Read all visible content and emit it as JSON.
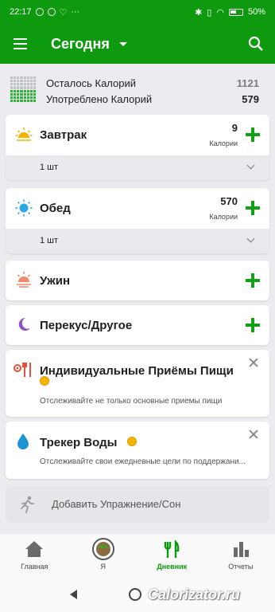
{
  "status_bar": {
    "time": "22:17",
    "battery": "50"
  },
  "app": {
    "title": "Сегодня"
  },
  "summary": {
    "remaining_label": "Осталось Калорий",
    "remaining_value": "1121",
    "consumed_label": "Употреблено Калорий",
    "consumed_value": "579"
  },
  "meals": [
    {
      "name": "Завтрак",
      "calories": "9",
      "unit": "Калории",
      "serving": "1 шт",
      "icon": "sunrise-icon"
    },
    {
      "name": "Обед",
      "calories": "570",
      "unit": "Калории",
      "serving": "1 шт",
      "icon": "sun-icon"
    },
    {
      "name": "Ужин",
      "icon": "sunset-icon"
    },
    {
      "name": "Перекус/Другое",
      "icon": "moon-icon"
    }
  ],
  "individual_meals": {
    "title": "Индивидуальные Приёмы Пищи",
    "subtitle": "Отслеживайте не только основные приемы пищи"
  },
  "water_tracker": {
    "title": "Трекер Воды",
    "subtitle": "Отслеживайте свои ежедневные цели по поддержани..."
  },
  "exercise": {
    "label": "Добавить Упражнение/Сон"
  },
  "bottom_nav": [
    {
      "label": "Главная"
    },
    {
      "label": "Я"
    },
    {
      "label": "Дневник"
    },
    {
      "label": "Отчеты"
    }
  ],
  "colors": {
    "brand_green": "#0e9a0f",
    "plus_green": "#12a016",
    "background": "#ececf0"
  },
  "watermark": "Calorizator.ru"
}
